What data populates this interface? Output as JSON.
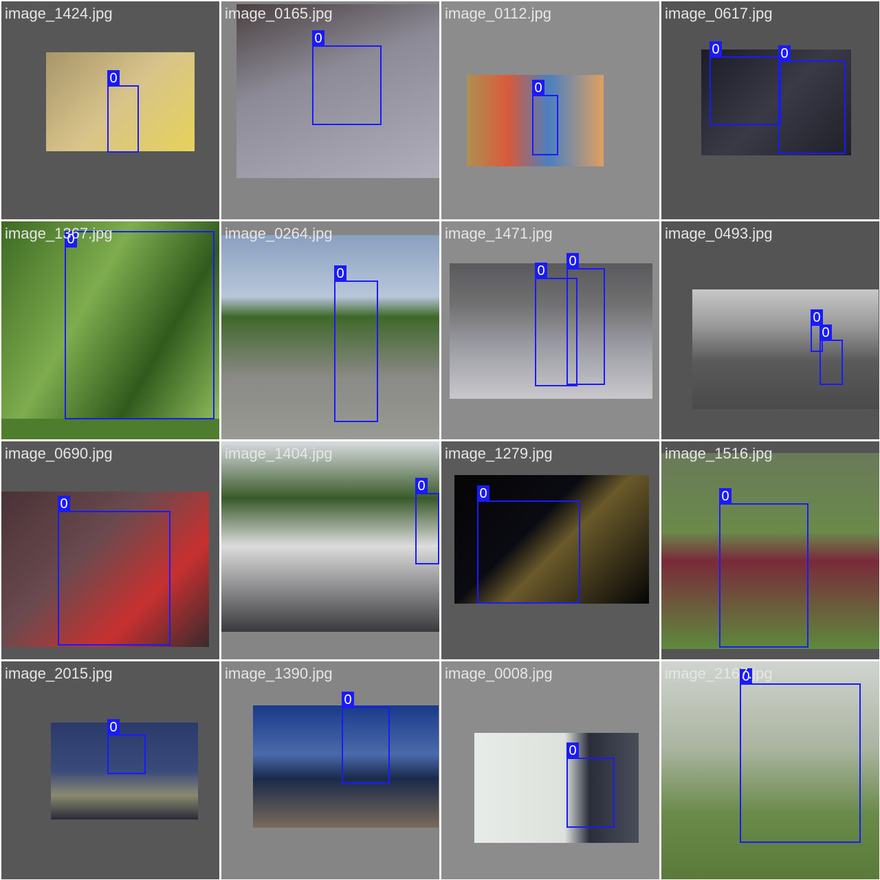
{
  "colors": {
    "box": "#1a1aff",
    "label_text": "#ffffff",
    "filename_text": "#e6e6e6"
  },
  "tiles": [
    {
      "filename": "image_1424.jpg",
      "bg": "#575757",
      "img": "linear-gradient(135deg,#a8956a,#d8c48a 50%,#e6d25a)",
      "boxes": [
        {
          "label": "0"
        }
      ]
    },
    {
      "filename": "image_0165.jpg",
      "bg": "#858585",
      "img": "linear-gradient(160deg,#4a4040,#8c8a96 40%,#b0aebb)",
      "boxes": [
        {
          "label": "0"
        }
      ]
    },
    {
      "filename": "image_0112.jpg",
      "bg": "#8c8c8c",
      "img": "linear-gradient(90deg,#b09050,#d85a3a 30%,#4a80c0 60%,#e0a060)",
      "boxes": [
        {
          "label": "0"
        }
      ]
    },
    {
      "filename": "image_0617.jpg",
      "bg": "#545454",
      "img": "linear-gradient(135deg,#1c1c28,#3a3a46 50%,#20202a)",
      "boxes": [
        {
          "label": "0"
        },
        {
          "label": "0"
        }
      ]
    },
    {
      "filename": "image_1367.jpg",
      "bg": "#4e7d2e",
      "img": "linear-gradient(120deg,#3c6a22,#7eac4e 40%,#2f5a1c 70%,#8fbc5c)",
      "boxes": [
        {
          "label": "0"
        }
      ]
    },
    {
      "filename": "image_0264.jpg",
      "bg": "#858585",
      "img": "linear-gradient(180deg,#8aa0c0 0%,#b8c6da 30%,#40682a 40%,#8a8a86 70%,#9a9a94)",
      "boxes": [
        {
          "label": "0"
        }
      ]
    },
    {
      "filename": "image_1471.jpg",
      "bg": "#8c8c8c",
      "img": "linear-gradient(180deg,#5a5a5e 0%,#707070 30%,#9a9aa2 60%,#c8c8cc)",
      "boxes": [
        {
          "label": "0"
        },
        {
          "label": "0"
        }
      ]
    },
    {
      "filename": "image_0493.jpg",
      "bg": "#545454",
      "img": "linear-gradient(180deg,#c8c8c8 0%,#9a9a9a 30%,#5a5a5a 60%,#4a4a4a)",
      "boxes": [
        {
          "label": "0"
        },
        {
          "label": "0"
        }
      ]
    },
    {
      "filename": "image_0690.jpg",
      "bg": "#575757",
      "img": "linear-gradient(135deg,#4a3236,#6a4a4e 40%,#c83030 70%,#3a2a2e)",
      "boxes": [
        {
          "label": "0"
        }
      ]
    },
    {
      "filename": "image_1404.jpg",
      "bg": "#858585",
      "img": "linear-gradient(180deg,#d8dce0 0%,#3a5a2a 30%,#dcdcdc 55%,#3a3a3e)",
      "boxes": [
        {
          "label": "0"
        }
      ]
    },
    {
      "filename": "image_1279.jpg",
      "bg": "#5a5a5a",
      "img": "linear-gradient(135deg,#050505,#0a0a12 40%,#6a5a2a 55%,#050505)",
      "boxes": [
        {
          "label": "0"
        }
      ]
    },
    {
      "filename": "image_1516.jpg",
      "bg": "#545454",
      "img": "linear-gradient(180deg,#6a7a5a 0%,#6a8a4a 40%,#7a2a3a 55%,#5e8a3e)",
      "boxes": [
        {
          "label": "0"
        }
      ]
    },
    {
      "filename": "image_2015.jpg",
      "bg": "#575757",
      "img": "linear-gradient(180deg,#2a3a6a 0%,#3a4a7a 50%,#8a8a70 75%,#2a2a3a)",
      "boxes": [
        {
          "label": "0"
        }
      ]
    },
    {
      "filename": "image_1390.jpg",
      "bg": "#858585",
      "img": "linear-gradient(180deg,#1a3a8a 0%,#4a6aaa 40%,#1a2a4a 60%,#7a6a5a)",
      "boxes": [
        {
          "label": "0"
        }
      ]
    },
    {
      "filename": "image_0008.jpg",
      "bg": "#8c8c8c",
      "img": "linear-gradient(90deg,#e8ece8,#dde2dd 55%,#2a2e3a 70%,#4a4e5a)",
      "boxes": [
        {
          "label": "0"
        }
      ]
    },
    {
      "filename": "image_2167.jpg",
      "bg": "#c8ccc8",
      "img": "linear-gradient(180deg,#d0d4d0 0%,#aab4a0 40%,#6a8a4a 70%,#5a7a3a)",
      "boxes": [
        {
          "label": "0"
        }
      ]
    }
  ]
}
